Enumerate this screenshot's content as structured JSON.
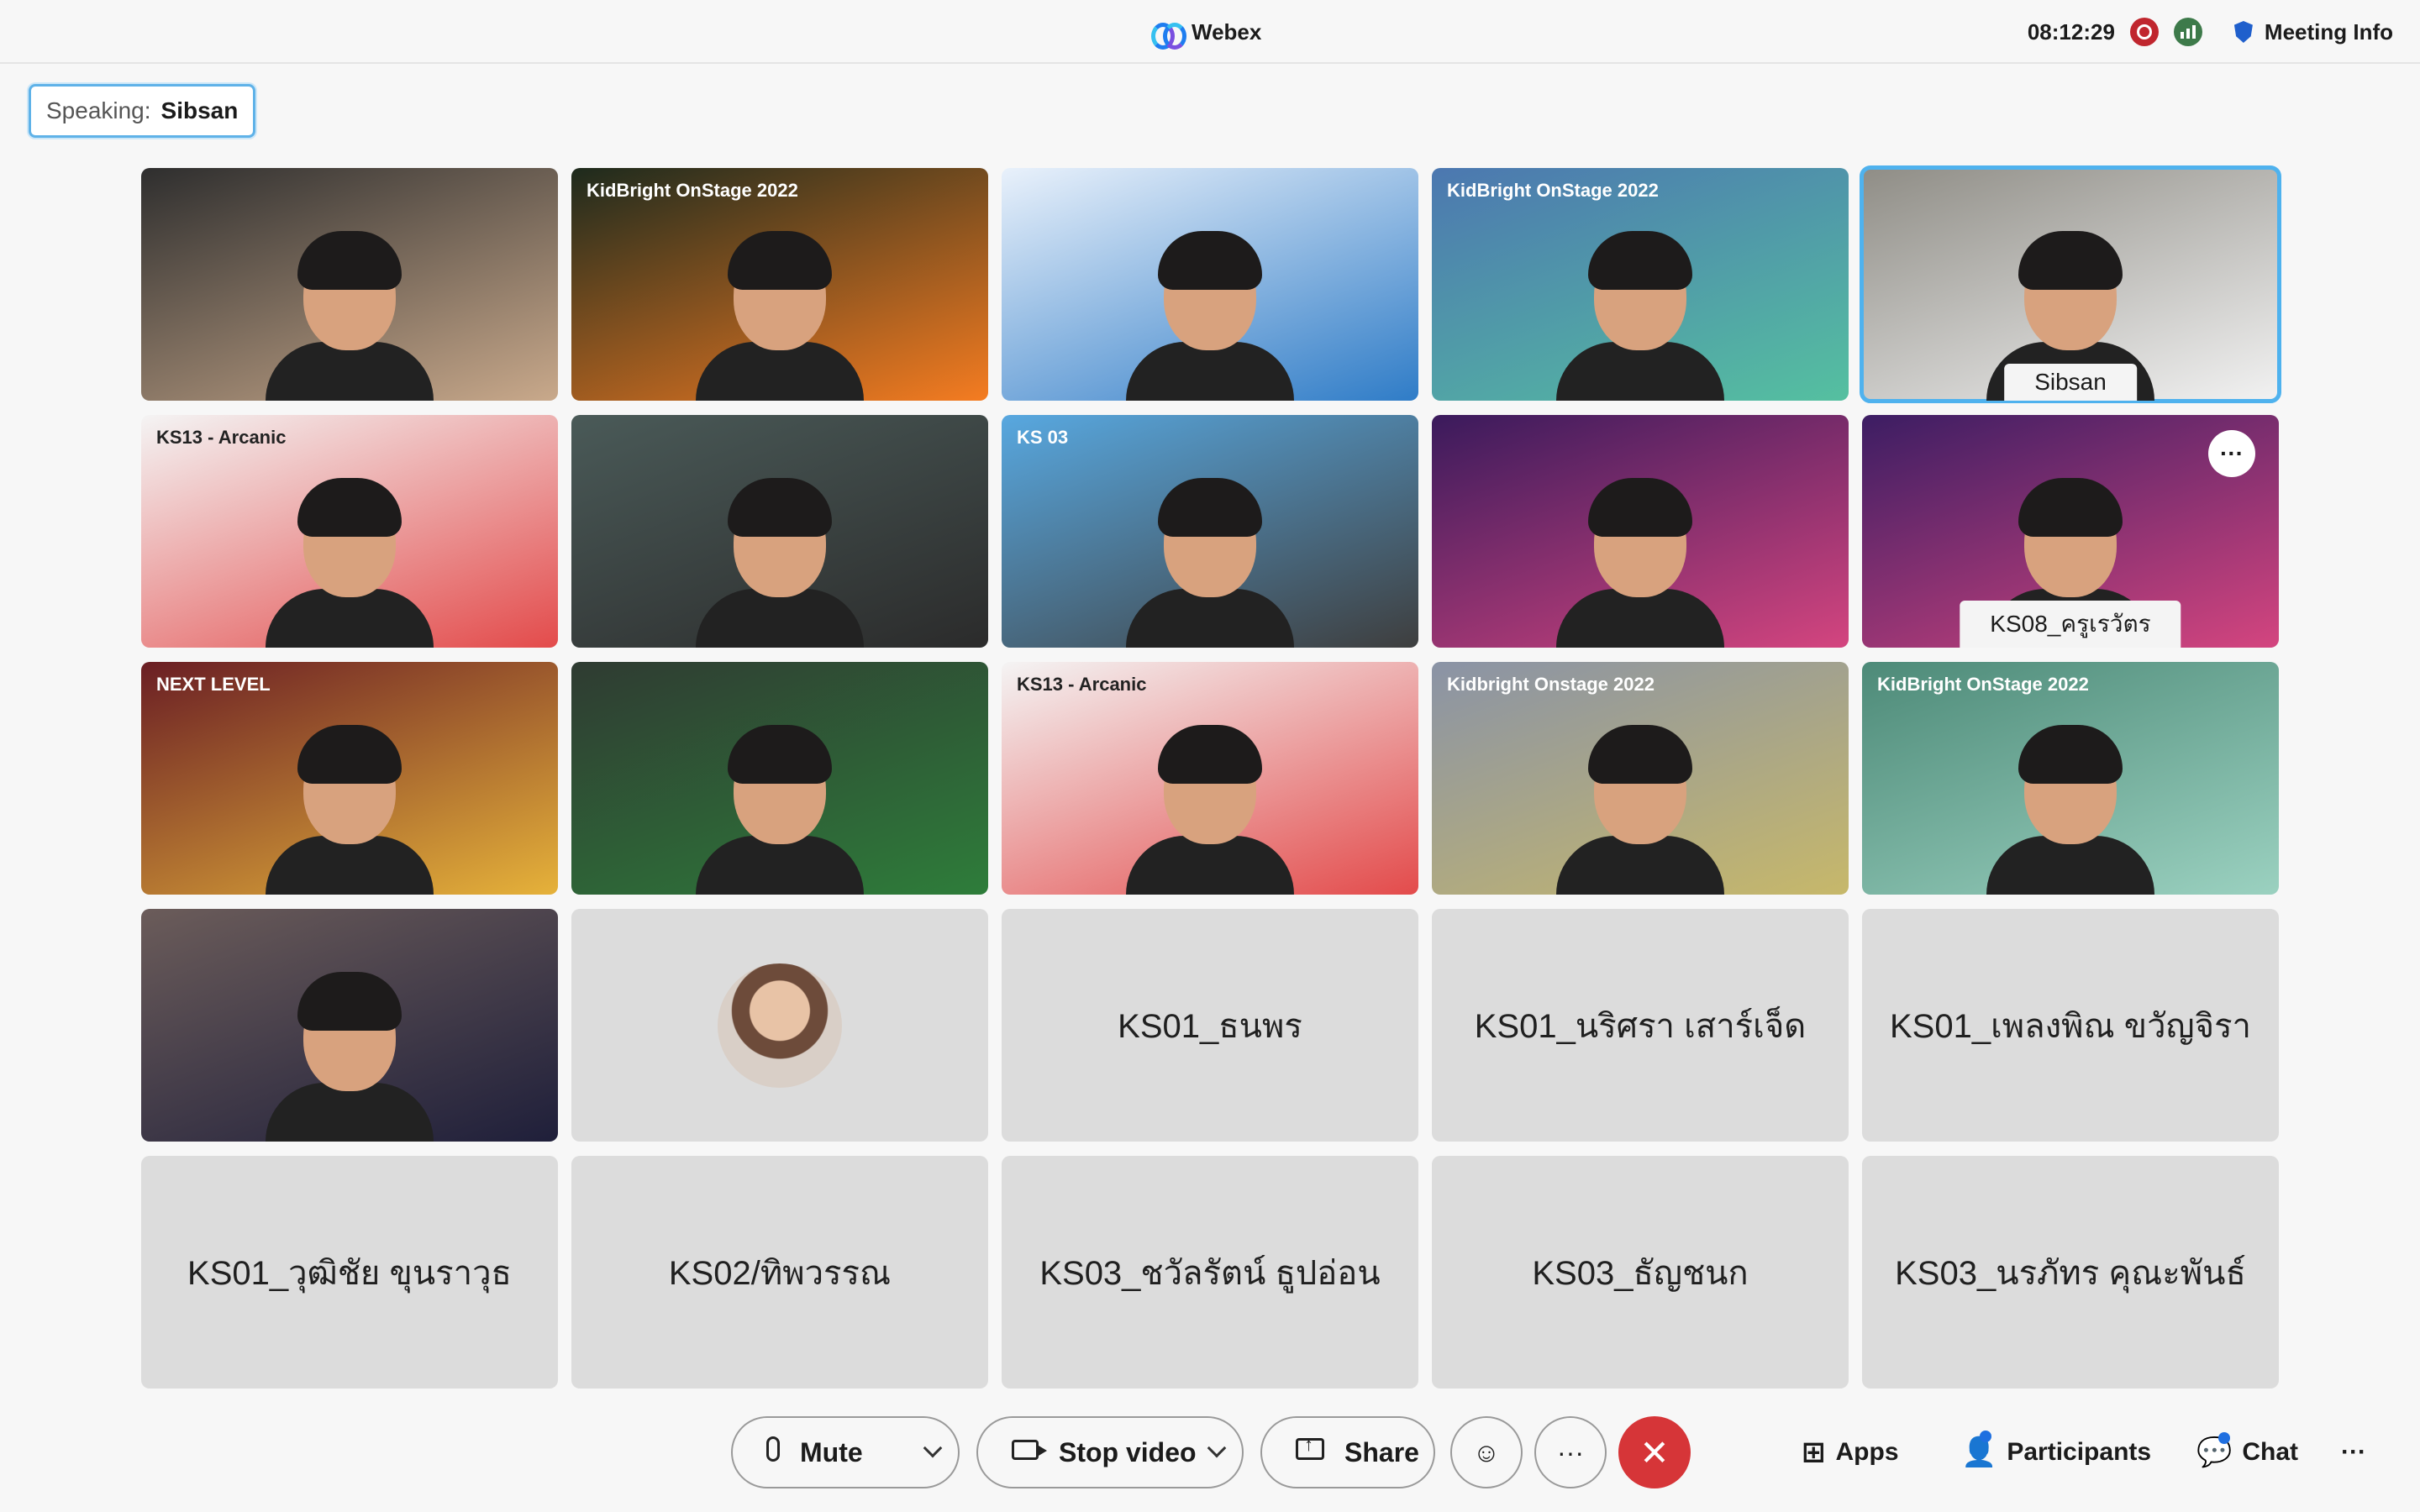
{
  "window": {
    "app_title": "Webex",
    "clock": "08:12:29",
    "meeting_info_label": "Meeting Info"
  },
  "speaking": {
    "label": "Speaking:",
    "name": "Sibsan"
  },
  "tiles": [
    {
      "kind": "video",
      "bg": "#2e2e2e",
      "accent": "#c9a98b"
    },
    {
      "kind": "video",
      "bg": "#1d2a1d",
      "accent": "#f57c21",
      "overlay": "KidBright\nOnStage 2022"
    },
    {
      "kind": "video",
      "bg": "#e9f1fb",
      "accent": "#2f7cc7"
    },
    {
      "kind": "video",
      "bg": "#4c77b0",
      "accent": "#55c0a0",
      "overlay": "KidBright OnStage 2022"
    },
    {
      "kind": "video",
      "bg": "#8f8d86",
      "accent": "#f2f2f2",
      "active": true,
      "name": "Sibsan"
    },
    {
      "kind": "video",
      "bg": "#f4f4f4",
      "accent": "#e34b4b",
      "overlay": "KS13 - Arcanic"
    },
    {
      "kind": "video",
      "bg": "#4a5a58",
      "accent": "#2b2b2b"
    },
    {
      "kind": "video",
      "bg": "#58a8e0",
      "accent": "#3e3e3e",
      "overlay": "KS 03"
    },
    {
      "kind": "video",
      "bg": "#3a1a5c",
      "accent": "#d4457f"
    },
    {
      "kind": "video",
      "bg": "#3c1d63",
      "accent": "#d4457f",
      "name": "KS08_ครูเรวัตร",
      "more": true
    },
    {
      "kind": "video",
      "bg": "#6a1e24",
      "accent": "#e6b23a",
      "overlay": "NEXT LEVEL"
    },
    {
      "kind": "video",
      "bg": "#2f3b32",
      "accent": "#2e7d3a"
    },
    {
      "kind": "video",
      "bg": "#f4f4f4",
      "accent": "#e34b4b",
      "overlay": "KS13 - Arcanic"
    },
    {
      "kind": "video",
      "bg": "#8a93a6",
      "accent": "#c7b86a",
      "overlay": "Kidbright Onstage 2022"
    },
    {
      "kind": "video",
      "bg": "#4d8a78",
      "accent": "#9bd1c0",
      "overlay": "KidBright OnStage 2022"
    },
    {
      "kind": "video",
      "bg": "#6b5c5a",
      "accent": "#1f1f3a"
    },
    {
      "kind": "avatar"
    },
    {
      "kind": "name",
      "name": "KS01_ธนพร"
    },
    {
      "kind": "name",
      "name": "KS01_นริศรา เสาร์เจ็ด"
    },
    {
      "kind": "name",
      "name": "KS01_เพลงพิณ ขวัญจิรา"
    },
    {
      "kind": "name",
      "name": "KS01_วุฒิชัย ขุนราวุธ"
    },
    {
      "kind": "name",
      "name": "KS02/ทิพวรรณ"
    },
    {
      "kind": "name",
      "name": "KS03_ชวัลรัตน์ ธูปอ่อน"
    },
    {
      "kind": "name",
      "name": "KS03_ธัญชนก"
    },
    {
      "kind": "name",
      "name": "KS03_นรภัทร คุณะพันธ์"
    }
  ],
  "toolbar": {
    "mute_label": "Mute",
    "stop_video_label": "Stop video",
    "share_label": "Share",
    "apps_label": "Apps",
    "participants_label": "Participants",
    "chat_label": "Chat"
  },
  "icons": {
    "mute": "microphone-icon",
    "video": "camera-icon",
    "share": "share-screen-icon",
    "reactions": "emoji-icon",
    "more": "more-icon",
    "leave": "close-icon",
    "apps": "apps-grid-icon",
    "participants": "person-icon",
    "chat": "chat-bubble-icon"
  },
  "colors": {
    "accent": "#4fb2ee",
    "leave": "#d63538",
    "recording": "#c0262e",
    "network": "#3d7a4a"
  }
}
